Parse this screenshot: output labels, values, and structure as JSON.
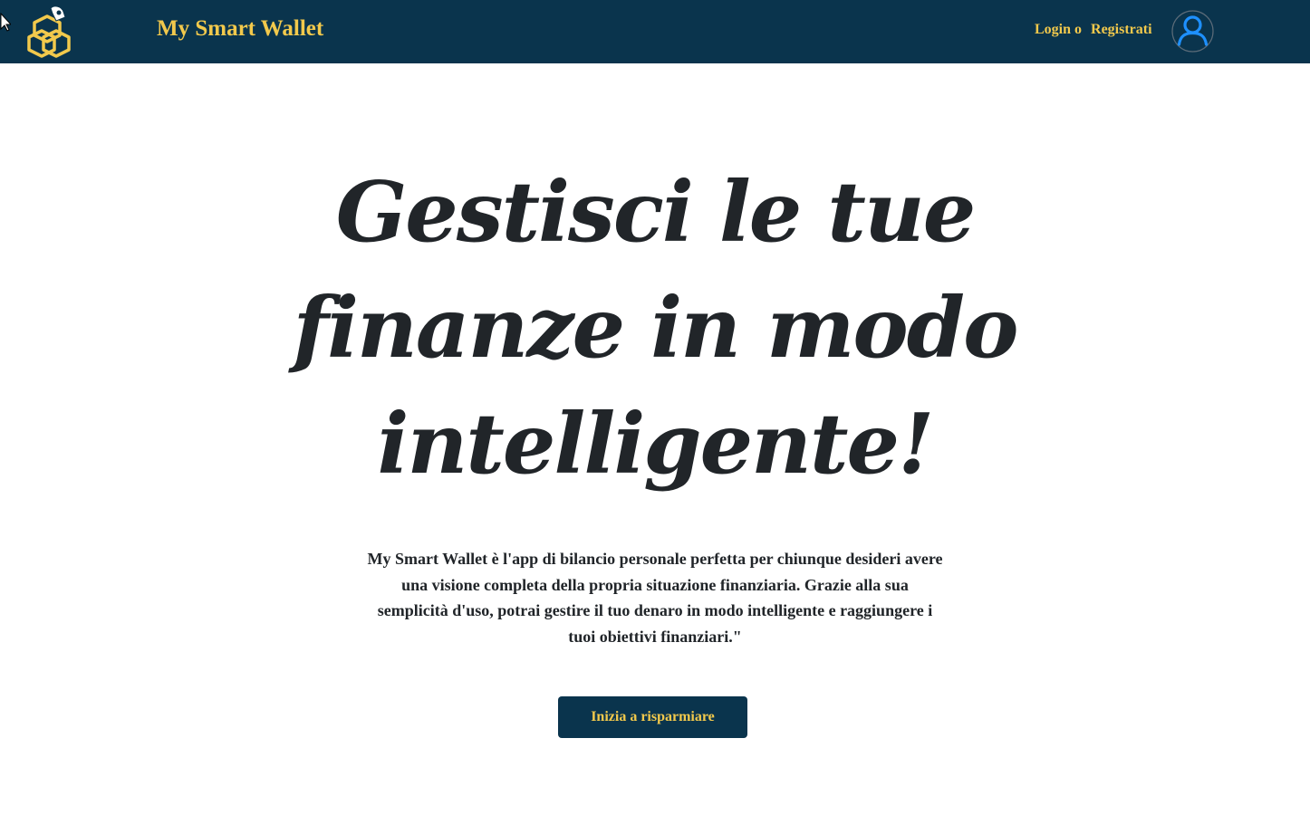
{
  "navbar": {
    "brand": "My Smart Wallet",
    "login_label": "Login o",
    "register_label": "Registrati",
    "logo_icon": "wallet-hexagon-logo-icon",
    "avatar_icon": "user-avatar-icon"
  },
  "hero": {
    "title": "Gestisci le tue finanze in modo intelligente!",
    "description": "My Smart Wallet è l'app di bilancio personale perfetta per chiunque desideri avere una visione completa della propria situazione finanziaria. Grazie alla sua semplicità d'uso, potrai gestire il tuo denaro in modo intelligente e raggiungere i tuoi obiettivi finanziari.\"",
    "cta_label": "Inizia a risparmiare"
  },
  "colors": {
    "navbar_bg": "#0a344d",
    "accent": "#f2c94c",
    "text": "#212529",
    "avatar_blue": "#1e90ff"
  }
}
